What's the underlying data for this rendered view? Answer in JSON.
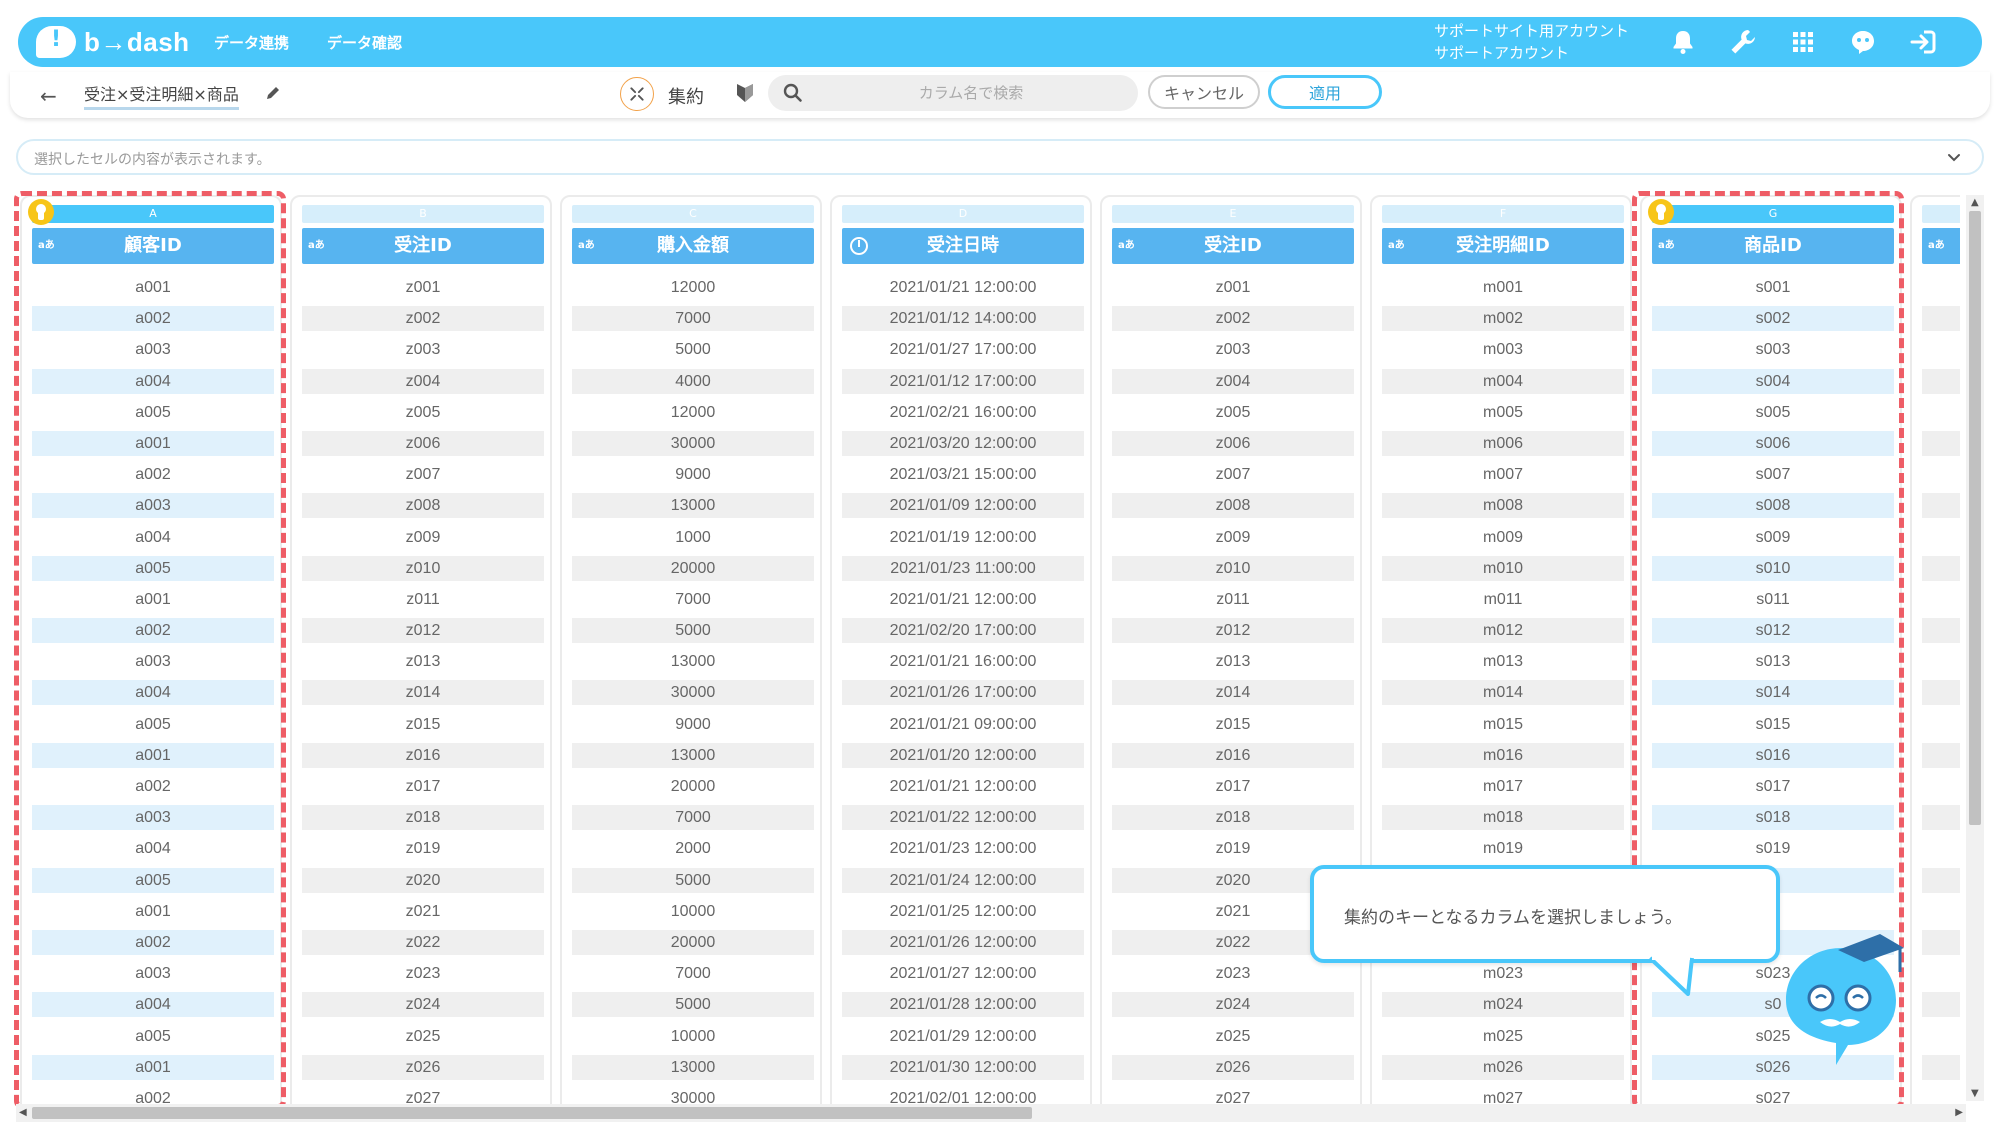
{
  "app": {
    "logo_text": "b→dash",
    "nav": [
      "データ連携",
      "データ確認"
    ],
    "account_line1": "サポートサイト用アカウント",
    "account_line2": "サポートアカウント"
  },
  "toolbar": {
    "breadcrumb": "受注×受注明細×商品",
    "agg_label": "集約",
    "search_placeholder": "カラム名で検索",
    "cancel_label": "キャンセル",
    "apply_label": "適用"
  },
  "cellbar": {
    "placeholder": "選択したセルの内容が表示されます。"
  },
  "tooltip": {
    "text": "集約のキーとなるカラムを選択しましょう。"
  },
  "colors": {
    "brand": "#49c7fa",
    "header": "#57b4f0",
    "highlight": "#ee5d66",
    "key_pin": "#f7c518"
  },
  "columns": [
    {
      "letter": "A",
      "header": "顧客ID",
      "type": "text",
      "key": true,
      "values": [
        "a001",
        "a002",
        "a003",
        "a004",
        "a005",
        "a001",
        "a002",
        "a003",
        "a004",
        "a005",
        "a001",
        "a002",
        "a003",
        "a004",
        "a005",
        "a001",
        "a002",
        "a003",
        "a004",
        "a005",
        "a001",
        "a002",
        "a003",
        "a004",
        "a005",
        "a001",
        "a002"
      ]
    },
    {
      "letter": "B",
      "header": "受注ID",
      "type": "text",
      "key": false,
      "values": [
        "z001",
        "z002",
        "z003",
        "z004",
        "z005",
        "z006",
        "z007",
        "z008",
        "z009",
        "z010",
        "z011",
        "z012",
        "z013",
        "z014",
        "z015",
        "z016",
        "z017",
        "z018",
        "z019",
        "z020",
        "z021",
        "z022",
        "z023",
        "z024",
        "z025",
        "z026",
        "z027"
      ]
    },
    {
      "letter": "C",
      "header": "購入金額",
      "type": "text",
      "key": false,
      "values": [
        "12000",
        "7000",
        "5000",
        "4000",
        "12000",
        "30000",
        "9000",
        "13000",
        "1000",
        "20000",
        "7000",
        "5000",
        "13000",
        "30000",
        "9000",
        "13000",
        "20000",
        "7000",
        "2000",
        "5000",
        "10000",
        "20000",
        "7000",
        "5000",
        "10000",
        "13000",
        "30000"
      ]
    },
    {
      "letter": "D",
      "header": "受注日時",
      "type": "datetime",
      "key": false,
      "values": [
        "2021/01/21 12:00:00",
        "2021/01/12 14:00:00",
        "2021/01/27 17:00:00",
        "2021/01/12 17:00:00",
        "2021/02/21 16:00:00",
        "2021/03/20 12:00:00",
        "2021/03/21 15:00:00",
        "2021/01/09 12:00:00",
        "2021/01/19 12:00:00",
        "2021/01/23 11:00:00",
        "2021/01/21 12:00:00",
        "2021/02/20 17:00:00",
        "2021/01/21 16:00:00",
        "2021/01/26 17:00:00",
        "2021/01/21 09:00:00",
        "2021/01/20 12:00:00",
        "2021/01/21 12:00:00",
        "2021/01/22 12:00:00",
        "2021/01/23 12:00:00",
        "2021/01/24 12:00:00",
        "2021/01/25 12:00:00",
        "2021/01/26 12:00:00",
        "2021/01/27 12:00:00",
        "2021/01/28 12:00:00",
        "2021/01/29 12:00:00",
        "2021/01/30 12:00:00",
        "2021/02/01 12:00:00"
      ]
    },
    {
      "letter": "E",
      "header": "受注ID",
      "type": "text",
      "key": false,
      "values": [
        "z001",
        "z002",
        "z003",
        "z004",
        "z005",
        "z006",
        "z007",
        "z008",
        "z009",
        "z010",
        "z011",
        "z012",
        "z013",
        "z014",
        "z015",
        "z016",
        "z017",
        "z018",
        "z019",
        "z020",
        "z021",
        "z022",
        "z023",
        "z024",
        "z025",
        "z026",
        "z027"
      ]
    },
    {
      "letter": "F",
      "header": "受注明細ID",
      "type": "text",
      "key": false,
      "values": [
        "m001",
        "m002",
        "m003",
        "m004",
        "m005",
        "m006",
        "m007",
        "m008",
        "m009",
        "m010",
        "m011",
        "m012",
        "m013",
        "m014",
        "m015",
        "m016",
        "m017",
        "m018",
        "m019",
        "",
        "",
        "",
        "m023",
        "m024",
        "m025",
        "m026",
        "m027"
      ]
    },
    {
      "letter": "G",
      "header": "商品ID",
      "type": "text",
      "key": true,
      "values": [
        "s001",
        "s002",
        "s003",
        "s004",
        "s005",
        "s006",
        "s007",
        "s008",
        "s009",
        "s010",
        "s011",
        "s012",
        "s013",
        "s014",
        "s015",
        "s016",
        "s017",
        "s018",
        "s019",
        "",
        "",
        "",
        "s023",
        "s0",
        "s025",
        "s026",
        "s027"
      ]
    }
  ]
}
